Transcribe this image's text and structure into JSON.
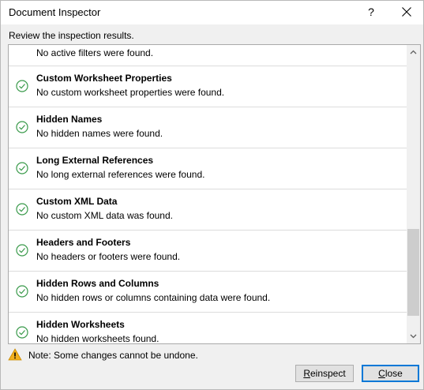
{
  "window": {
    "title": "Document Inspector",
    "help_label": "?"
  },
  "subtitle": "Review the inspection results.",
  "results": [
    {
      "title": "",
      "desc": "No active filters were found."
    },
    {
      "title": "Custom Worksheet Properties",
      "desc": "No custom worksheet properties were found."
    },
    {
      "title": "Hidden Names",
      "desc": "No hidden names were found."
    },
    {
      "title": "Long External References",
      "desc": "No long external references were found."
    },
    {
      "title": "Custom XML Data",
      "desc": "No custom XML data was found."
    },
    {
      "title": "Headers and Footers",
      "desc": "No headers or footers were found."
    },
    {
      "title": "Hidden Rows and Columns",
      "desc": "No hidden rows or columns containing data were found."
    },
    {
      "title": "Hidden Worksheets",
      "desc": "No hidden worksheets found."
    }
  ],
  "note": "Note: Some changes cannot be undone.",
  "buttons": {
    "reinspect_mnemonic": "R",
    "reinspect_rest": "einspect",
    "close_mnemonic": "C",
    "close_rest": "lose"
  },
  "colors": {
    "check": "#3a9a4b",
    "warning": "#f2b01e",
    "accent": "#0078d7"
  },
  "icons": {
    "row_status": "check-circle-icon",
    "note": "warning-icon"
  }
}
